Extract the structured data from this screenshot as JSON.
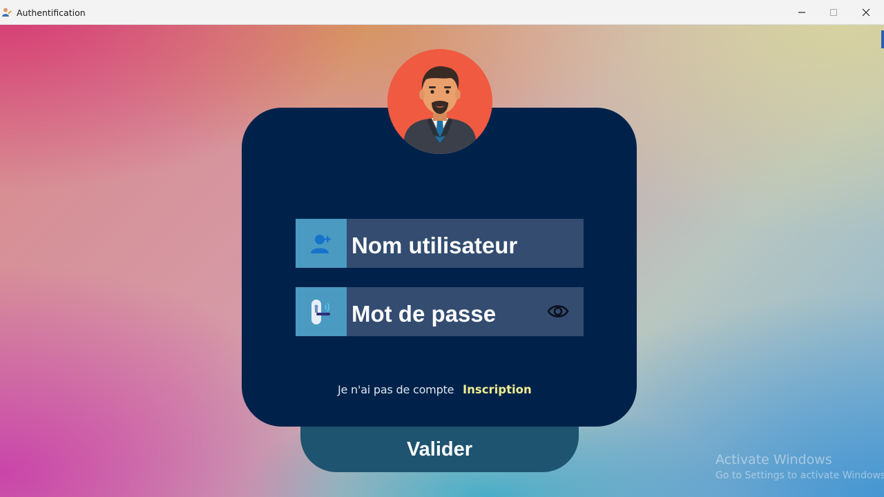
{
  "window": {
    "title": "Authentification",
    "app_icon": "user-pen-icon"
  },
  "form": {
    "username_placeholder": "Nom utilisateur",
    "password_placeholder": "Mot de passe",
    "username_icon": "add-user-icon",
    "password_icon": "door-lock-icon",
    "show_password_icon": "eye-icon",
    "avatar": "businessman-avatar"
  },
  "footer": {
    "no_account_text": "Je n'ai pas de compte",
    "signup_link": "Inscription"
  },
  "actions": {
    "submit_label": "Valider"
  },
  "watermark": {
    "title": "Activate Windows",
    "subtitle": "Go to Settings to activate Windows."
  },
  "colors": {
    "card": "#00224a",
    "field": "#334c70",
    "icon_box": "#4a9ac2",
    "link": "#f0ee90",
    "button": "#1e5470",
    "avatar_bg": "#ef5a41"
  }
}
